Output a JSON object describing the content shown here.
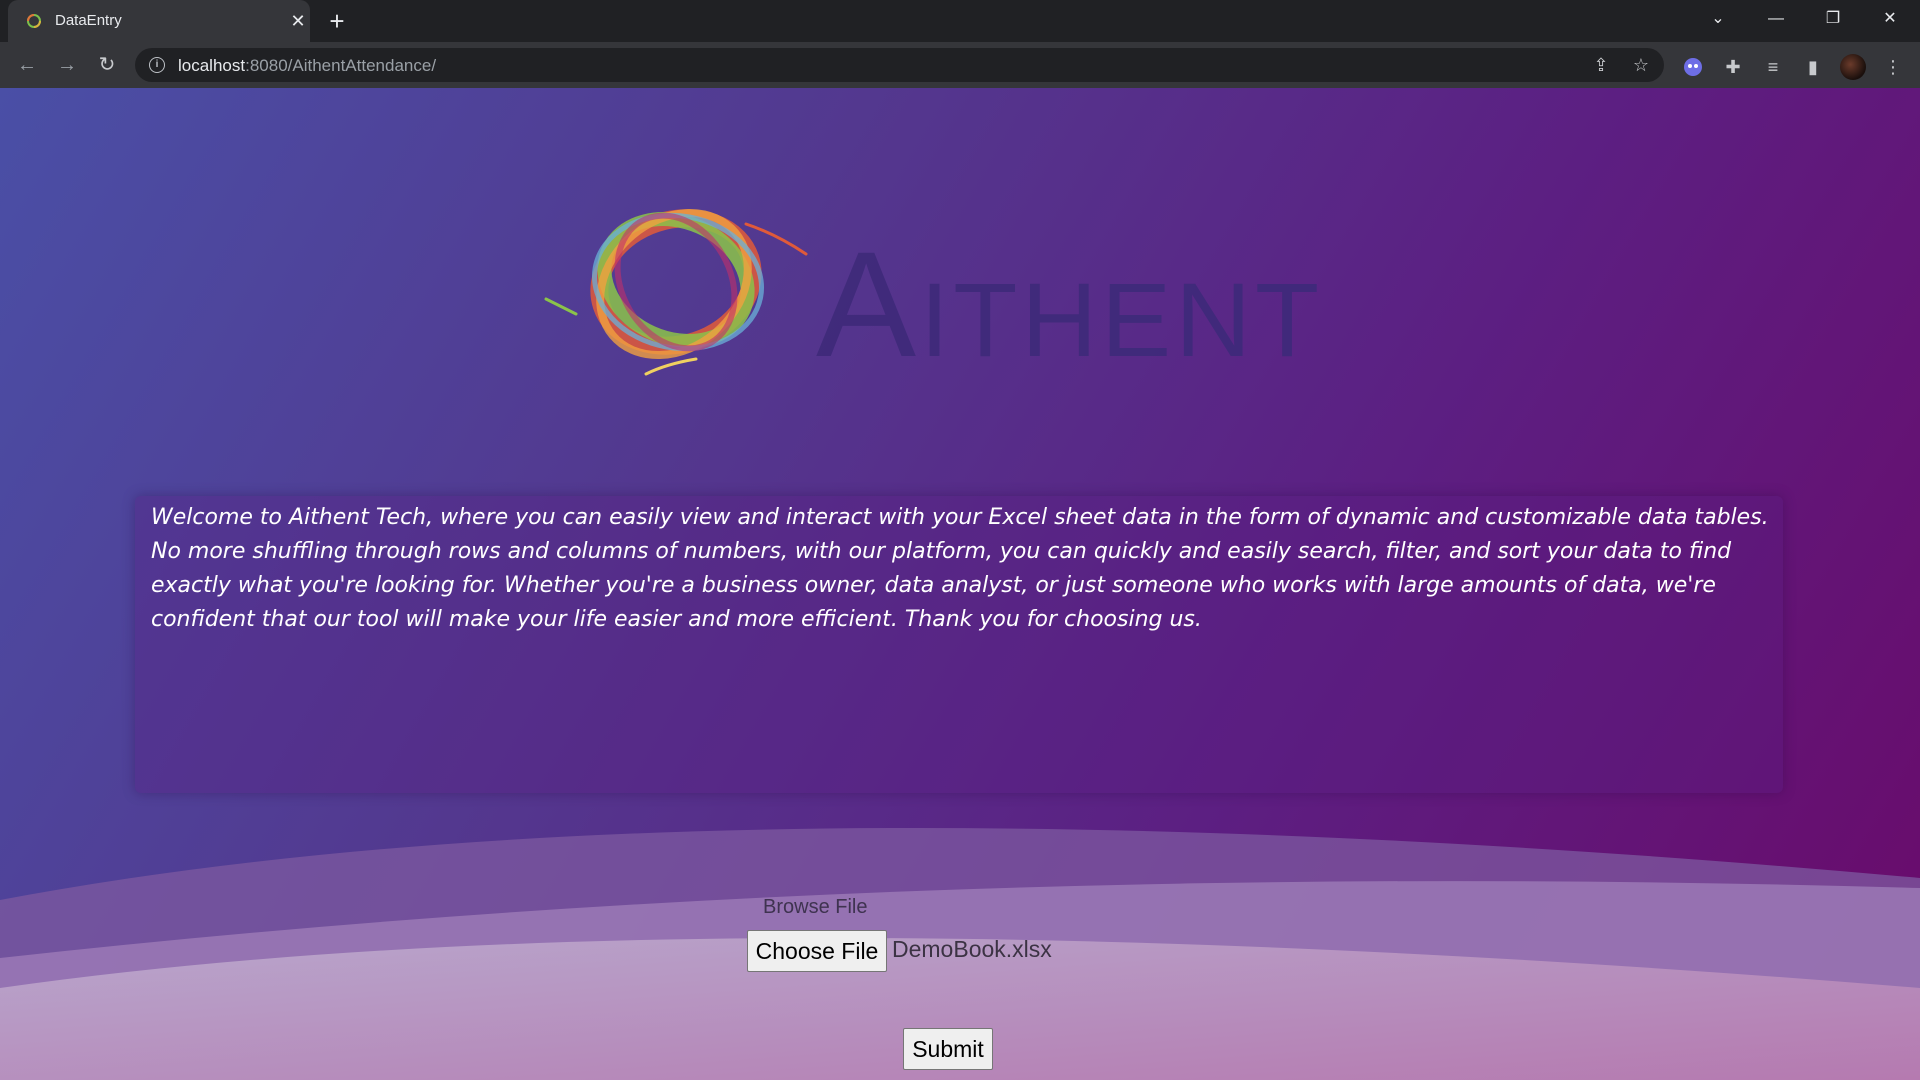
{
  "browser": {
    "tab_title": "DataEntry",
    "new_tab_symbol": "+",
    "url_host": "localhost",
    "url_path": ":8080/AithentAttendance/"
  },
  "logo": {
    "wordmark": "Aithent"
  },
  "welcome": {
    "text": "Welcome to Aithent Tech, where you can easily view and interact with your Excel sheet data in the form of dynamic and customizable data tables. No more shuffling through rows and columns of numbers, with our platform, you can quickly and easily search, filter, and sort your data to find exactly what you're looking for. Whether you're a business owner, data analyst, or just someone who works with large amounts of data, we're confident that our tool will make your life easier and more efficient. Thank you for choosing us."
  },
  "upload": {
    "label": "Browse File",
    "choose_button": "Choose File",
    "file_name": "DemoBook.xlsx",
    "submit_button": "Submit"
  },
  "colors": {
    "gradient_start": "#4a4fa6",
    "gradient_end": "#6a0a6a",
    "logo_text": "#3e2a7a"
  },
  "icons": [
    "back-icon",
    "forward-icon",
    "reload-icon",
    "info-icon",
    "share-icon",
    "bookmark-star-icon",
    "extension-icon",
    "puzzle-icon",
    "media-icon",
    "side-panel-icon",
    "menu-icon"
  ]
}
